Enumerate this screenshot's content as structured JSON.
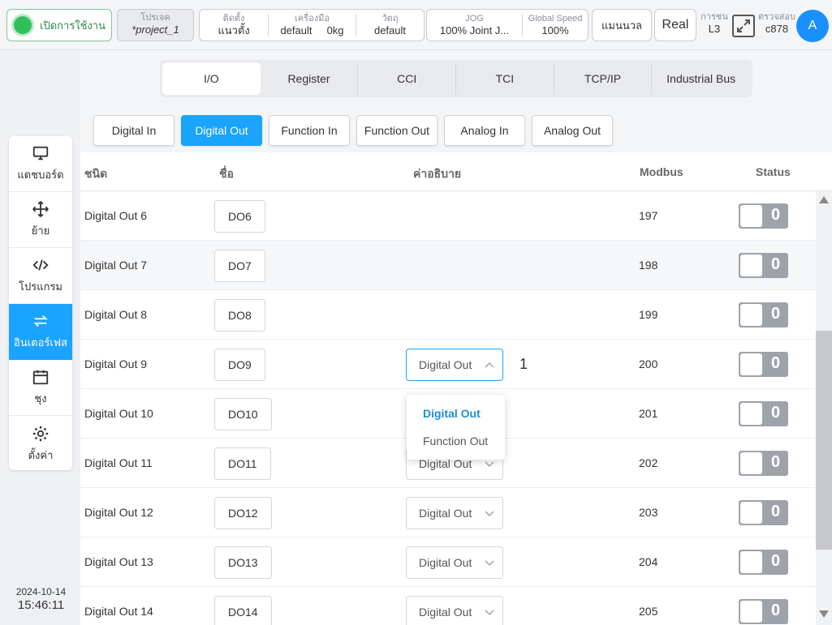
{
  "topbar": {
    "enable_label": "เปิดการใช้งาน",
    "project_label": "โปรเจค",
    "project_value": "*project_1",
    "install_label": "ติดตั้ง",
    "install_value": "แนวตั้ง",
    "tool_label": "เครื่องมือ",
    "tool_value": "default",
    "tool_weight": "0kg",
    "object_label": "วัตถุ",
    "object_value": "default",
    "jog_label": "JOG",
    "jog_value": "100%  Joint J...",
    "speed_label": "Global Speed",
    "speed_value": "100%",
    "manual_label": "แมนนวล",
    "real_label": "Real",
    "collision_label": "การชน",
    "collision_value": "L3",
    "check_label": "ตรวจสอบ",
    "check_value": "c878",
    "avatar_letter": "A"
  },
  "nav": [
    {
      "label": "แดชบอร์ด",
      "icon": "monitor-icon"
    },
    {
      "label": "ย้าย",
      "icon": "move-icon"
    },
    {
      "label": "โปรแกรม",
      "icon": "code-icon"
    },
    {
      "label": "อินเตอร์เฟส",
      "icon": "interface-icon"
    },
    {
      "label": "ชุง",
      "icon": "calendar-icon"
    },
    {
      "label": "ตั้งค่า",
      "icon": "gear-icon"
    }
  ],
  "datetime": {
    "date": "2024-10-14",
    "time": "15:46:11"
  },
  "tabs": [
    "I/O",
    "Register",
    "CCI",
    "TCI",
    "TCP/IP",
    "Industrial Bus"
  ],
  "subtabs": [
    "Digital In",
    "Digital Out",
    "Function In",
    "Function Out",
    "Analog In",
    "Analog Out"
  ],
  "table": {
    "headers": {
      "type": "ชนิด",
      "name": "ชื่อ",
      "description": "ค่าอธิบาย",
      "modbus": "Modbus",
      "status": "Status"
    },
    "rows": [
      {
        "type": "Digital Out 6",
        "name": "DO6",
        "desc": "",
        "modbus": "197",
        "status": "0"
      },
      {
        "type": "Digital Out 7",
        "name": "DO7",
        "desc": "",
        "modbus": "198",
        "status": "0"
      },
      {
        "type": "Digital Out 8",
        "name": "DO8",
        "desc": "",
        "modbus": "199",
        "status": "0"
      },
      {
        "type": "Digital Out 9",
        "name": "DO9",
        "desc": "Digital Out",
        "extra": "1",
        "modbus": "200",
        "status": "0"
      },
      {
        "type": "Digital Out 10",
        "name": "DO10",
        "desc": "",
        "modbus": "201",
        "status": "0"
      },
      {
        "type": "Digital Out 11",
        "name": "DO11",
        "desc": "Digital Out",
        "modbus": "202",
        "status": "0"
      },
      {
        "type": "Digital Out 12",
        "name": "DO12",
        "desc": "Digital Out",
        "modbus": "203",
        "status": "0"
      },
      {
        "type": "Digital Out 13",
        "name": "DO13",
        "desc": "Digital Out",
        "modbus": "204",
        "status": "0"
      },
      {
        "type": "Digital Out 14",
        "name": "DO14",
        "desc": "Digital Out",
        "modbus": "205",
        "status": "0"
      }
    ]
  },
  "dropdown": {
    "options": [
      "Digital Out",
      "Function Out"
    ],
    "selected": "Digital Out"
  },
  "colors": {
    "accent": "#1aa3ff",
    "enable_green": "#2fbf5c",
    "toggle_off": "#9ea3ab"
  }
}
